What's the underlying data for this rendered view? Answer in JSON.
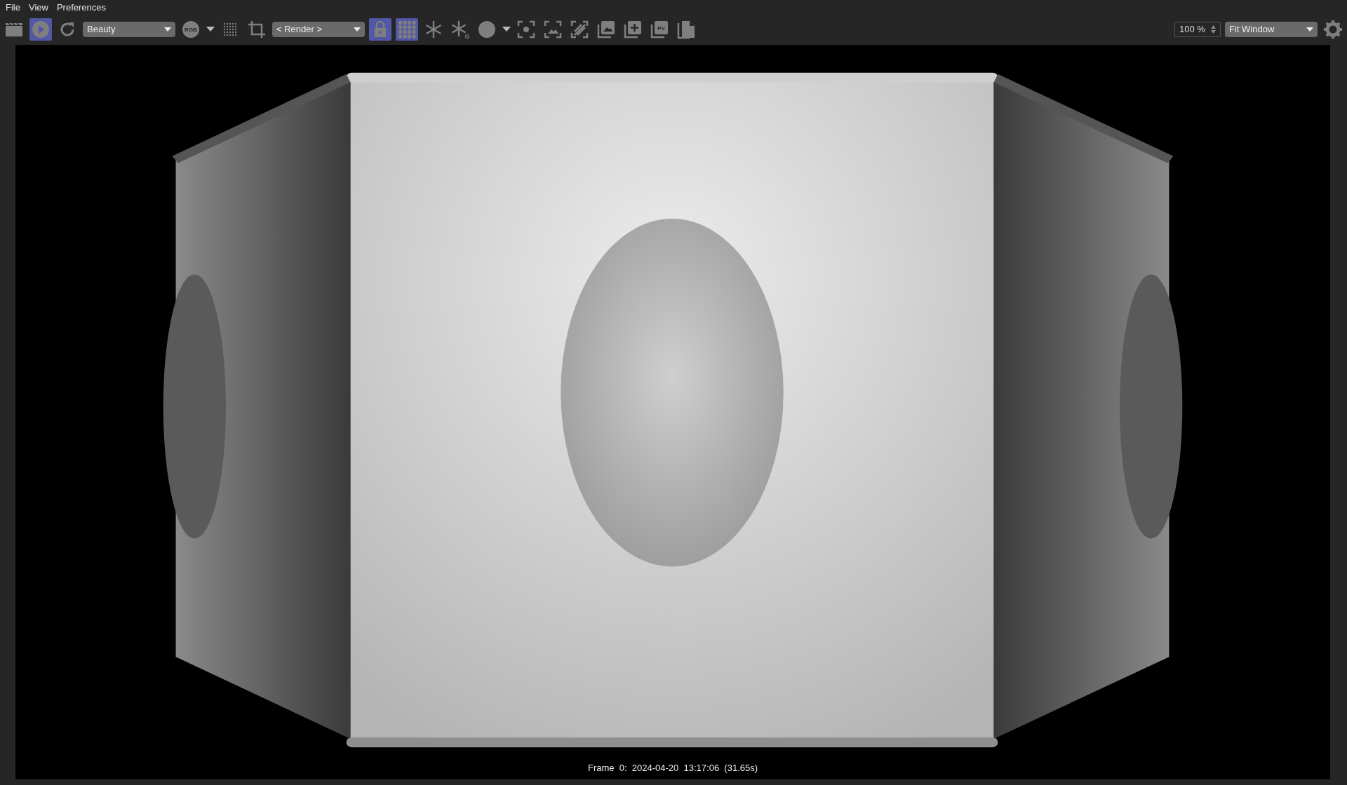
{
  "menu": [
    "File",
    "View",
    "Preferences"
  ],
  "toolbar": [
    {
      "kind": "button",
      "on": false
    },
    {
      "kind": "button",
      "on": true
    },
    {
      "kind": "button",
      "on": false
    },
    {
      "kind": "dropdown",
      "value": "Beauty"
    },
    {
      "kind": "button",
      "on": false,
      "label": "RGB"
    },
    {
      "kind": "caret"
    },
    {
      "kind": "button",
      "on": false
    },
    {
      "kind": "button",
      "on": false
    },
    {
      "kind": "dropdown",
      "value": "< Render >"
    },
    {
      "kind": "button",
      "on": true
    },
    {
      "kind": "button",
      "on": true
    },
    {
      "kind": "button",
      "on": false
    },
    {
      "kind": "button",
      "on": false,
      "label": "G"
    },
    {
      "kind": "button",
      "on": false
    },
    {
      "kind": "caret"
    },
    {
      "kind": "button",
      "on": false
    },
    {
      "kind": "button",
      "on": false
    },
    {
      "kind": "button",
      "on": false
    },
    {
      "kind": "button",
      "on": false
    },
    {
      "kind": "button",
      "on": false
    },
    {
      "kind": "button",
      "on": false,
      "label": "PV"
    },
    {
      "kind": "button",
      "on": false
    }
  ],
  "zoom": {
    "value": "100 %"
  },
  "fit": {
    "value": "Fit Window"
  },
  "viewer": {
    "caption": "Frame  0:  2024-04-20  13:17:06  (31.65s)"
  }
}
